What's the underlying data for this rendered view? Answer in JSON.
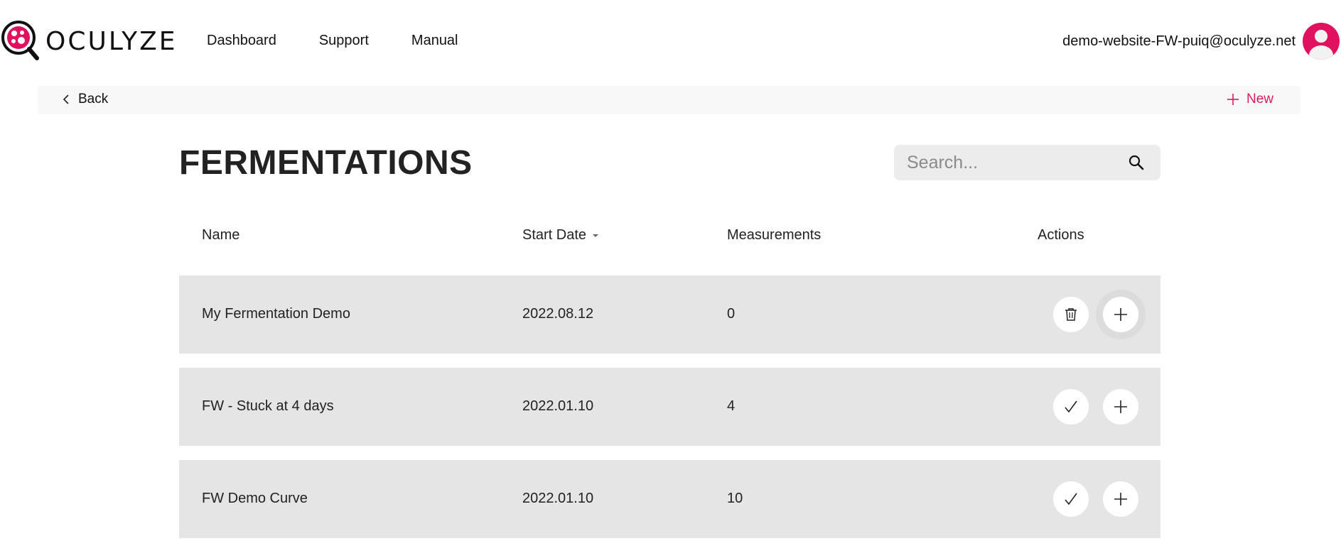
{
  "app": {
    "logo_text": "OCULYZE"
  },
  "nav": {
    "items": [
      "Dashboard",
      "Support",
      "Manual"
    ]
  },
  "user": {
    "email": "demo-website-FW-puiq@oculyze.net"
  },
  "subbar": {
    "back_label": "Back",
    "new_label": "New"
  },
  "page": {
    "title": "FERMENTATIONS"
  },
  "search": {
    "placeholder": "Search..."
  },
  "table": {
    "headers": {
      "name": "Name",
      "start_date": "Start Date",
      "measurements": "Measurements",
      "actions": "Actions"
    },
    "rows": [
      {
        "name": "My Fermentation Demo",
        "start_date": "2022.08.12",
        "measurements": "0",
        "first_action": "trash-icon"
      },
      {
        "name": "FW - Stuck at 4 days",
        "start_date": "2022.01.10",
        "measurements": "4",
        "first_action": "checkmark-icon"
      },
      {
        "name": "FW Demo Curve",
        "start_date": "2022.01.10",
        "measurements": "10",
        "first_action": "checkmark-icon"
      }
    ]
  },
  "colors": {
    "accent": "#e0115f",
    "new_link": "#d81b60",
    "row_bg": "#e5e5e5",
    "subbar_bg": "#f8f8f8"
  }
}
